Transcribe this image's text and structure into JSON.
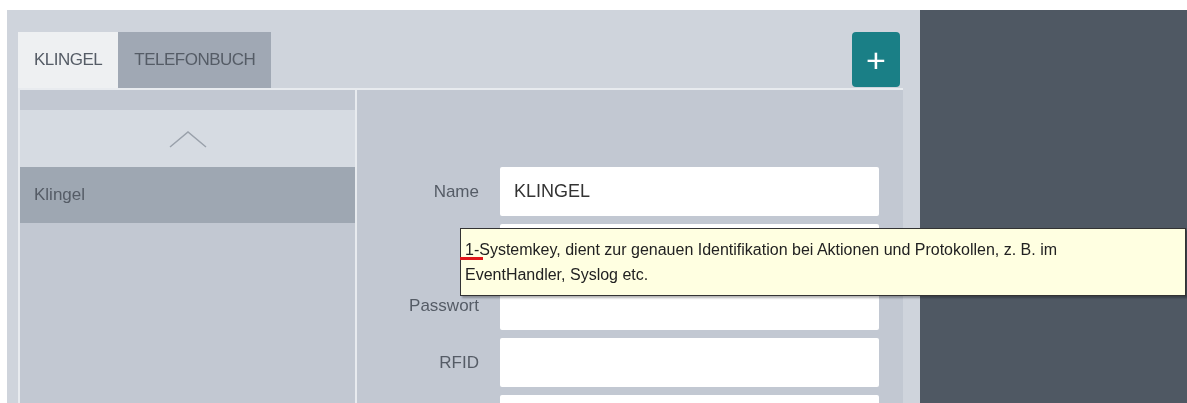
{
  "tabs": [
    {
      "label": "KLINGEL",
      "selected": true
    },
    {
      "label": "TELEFONBUCH",
      "selected": false
    }
  ],
  "add_button": {
    "label": "+"
  },
  "list": {
    "items": [
      {
        "label": "Klingel",
        "selected": true
      }
    ]
  },
  "form": {
    "fields": [
      {
        "kind": "text",
        "label": "Name",
        "value": "KLINGEL"
      },
      {
        "kind": "text"
      },
      {
        "kind": "text",
        "label": "Passwort"
      },
      {
        "kind": "text",
        "label": "RFID"
      },
      {
        "kind": "text"
      }
    ]
  },
  "tooltip": {
    "text": "1-Systemkey, dient zur genauen Identifikation bei Aktionen und Protokollen, z. B. im EventHandler, Syslog etc."
  }
}
